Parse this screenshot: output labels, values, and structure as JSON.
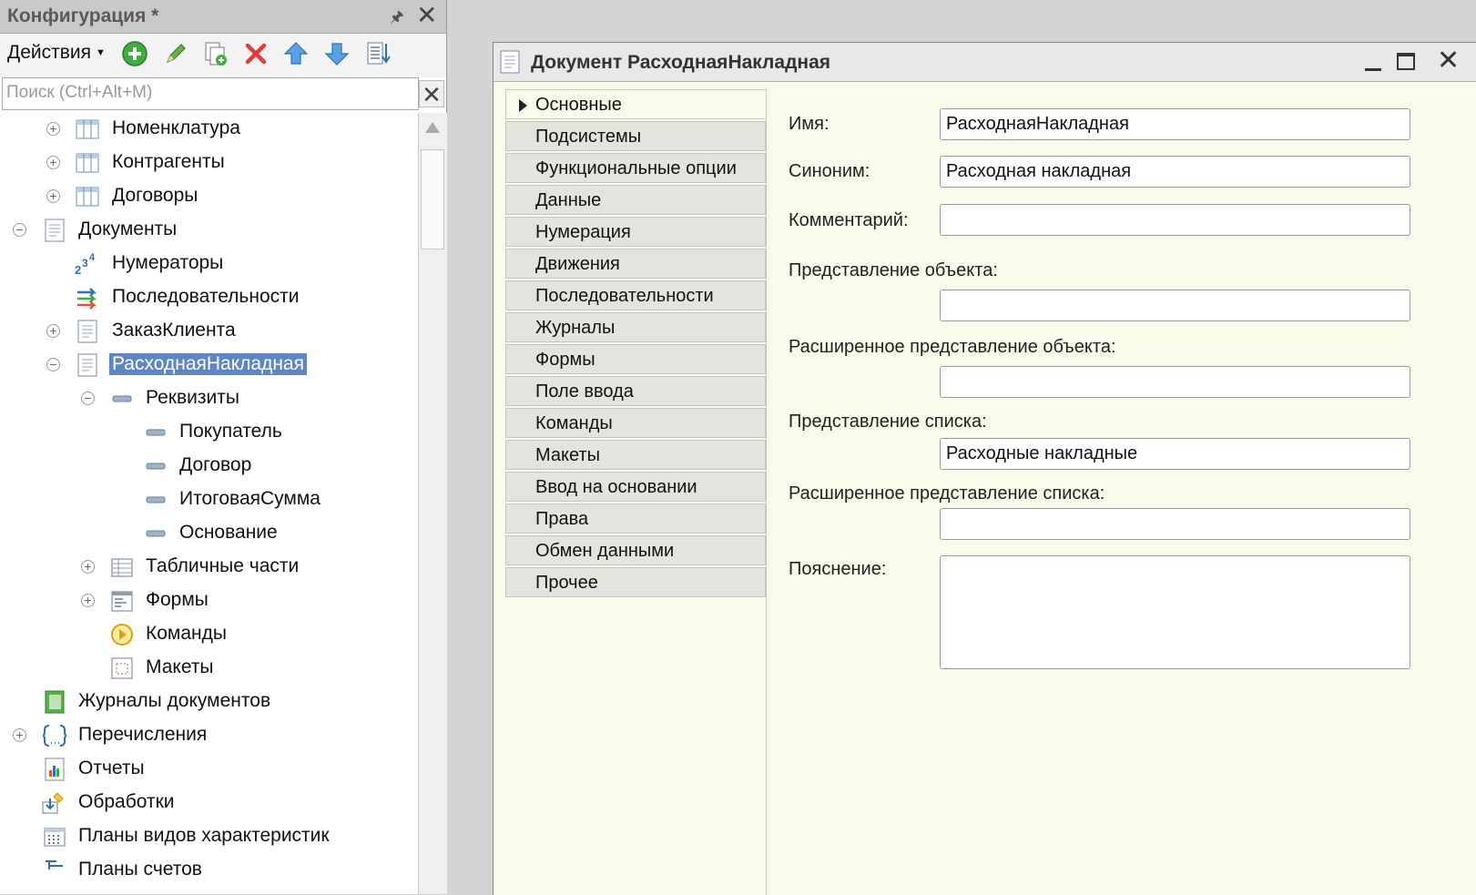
{
  "config_panel": {
    "title": "Конфигурация *",
    "actions_label": "Действия",
    "search_placeholder": "Поиск (Ctrl+Alt+M)",
    "tree": [
      "Номенклатура",
      "Контрагенты",
      "Договоры",
      "Документы",
      "Нумераторы",
      "Последовательности",
      "ЗаказКлиента",
      "РасходнаяНакладная",
      "Реквизиты",
      "Покупатель",
      "Договор",
      "ИтоговаяСумма",
      "Основание",
      "Табличные части",
      "Формы",
      "Команды",
      "Макеты",
      "Журналы документов",
      "Перечисления",
      "Отчеты",
      "Обработки",
      "Планы видов характеристик",
      "Планы счетов"
    ]
  },
  "document_window": {
    "title": "Документ РасходнаяНакладная",
    "tabs": [
      "Основные",
      "Подсистемы",
      "Функциональные опции",
      "Данные",
      "Нумерация",
      "Движения",
      "Последовательности",
      "Журналы",
      "Формы",
      "Поле ввода",
      "Команды",
      "Макеты",
      "Ввод на основании",
      "Права",
      "Обмен данными",
      "Прочее"
    ],
    "fields": {
      "name_label": "Имя:",
      "name_value": "РасходнаяНакладная",
      "synonym_label": "Синоним:",
      "synonym_value": "Расходная накладная",
      "comment_label": "Комментарий:",
      "comment_value": "",
      "object_presentation_label": "Представление объекта:",
      "object_presentation_value": "",
      "ext_object_presentation_label": "Расширенное представление объекта:",
      "ext_object_presentation_value": "",
      "list_presentation_label": "Представление списка:",
      "list_presentation_value": "Расходные накладные",
      "ext_list_presentation_label": "Расширенное представление списка:",
      "ext_list_presentation_value": "",
      "explanation_label": "Пояснение:",
      "explanation_value": ""
    }
  },
  "colors": {
    "selection": "#5f86c2",
    "window_background": "#fafaea",
    "panel_title": "#c9c9c9"
  }
}
